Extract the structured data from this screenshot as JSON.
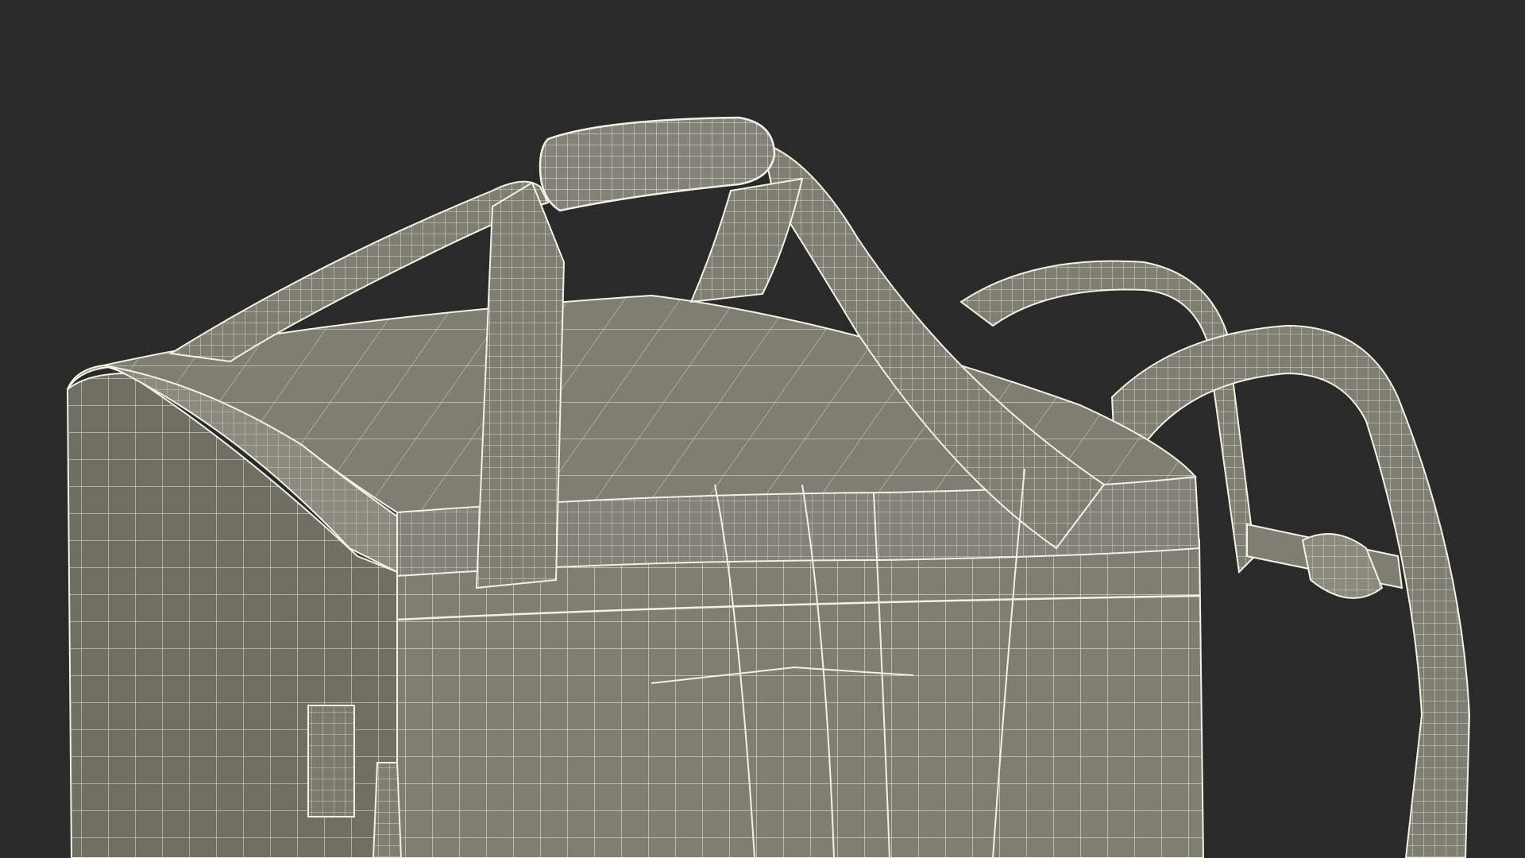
{
  "scene": {
    "background_color": "#2a2a2a",
    "mesh_fill_color": "#7e7e72",
    "mesh_shade_color": "#6f6f64",
    "mesh_light_color": "#8a8a7e",
    "wire_color": "#f2f1e6",
    "subject": "bag-wireframe-model"
  }
}
